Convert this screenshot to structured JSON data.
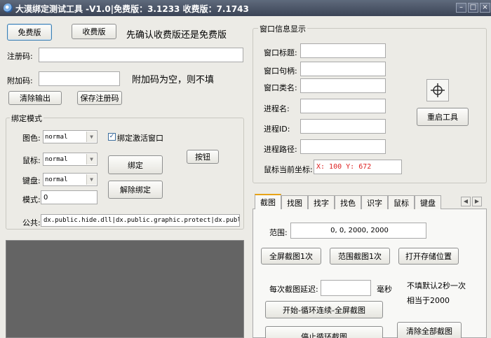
{
  "window": {
    "title": "大漠绑定测试工具 -V1.0|免费版：3.1233 收费版：7.1743",
    "min_glyph": "–",
    "max_glyph": "□",
    "close_glyph": "×"
  },
  "top": {
    "free_btn": "免费版",
    "paid_btn": "收费版",
    "hint": "先确认收费版还是免费版",
    "reg_label": "注册码:",
    "reg_value": "",
    "extra_label": "附加码:",
    "extra_value": "",
    "extra_hint": "附加码为空，则不填",
    "clear_btn": "清除输出",
    "save_reg_btn": "保存注册码"
  },
  "bind": {
    "legend": "绑定模式",
    "display_label": "图色:",
    "display_value": "normal",
    "mouse_label": "鼠标:",
    "mouse_value": "normal",
    "keypad_label": "键盘:",
    "keypad_value": "normal",
    "mode_label": "模式:",
    "mode_value": "0",
    "activate_label": "绑定激活窗口",
    "activate_checked": true,
    "bind_btn": "绑定",
    "unbind_btn": "解除绑定",
    "button_btn": "按钮",
    "public_label": "公共:",
    "public_value": "dx.public.hide.dll|dx.public.graphic.protect|dx.public"
  },
  "wininfo": {
    "legend": "窗口信息显示",
    "title_label": "窗口标题:",
    "title_value": "",
    "handle_label": "窗口句柄:",
    "handle_value": "",
    "class_label": "窗口类名:",
    "class_value": "",
    "proc_label": "进程名:",
    "proc_value": "",
    "pid_label": "进程ID:",
    "pid_value": "",
    "path_label": "进程路径:",
    "path_value": "",
    "mouse_label": "鼠标当前坐标:",
    "mouse_value": "X:   100  Y:   672",
    "restart_btn": "重启工具",
    "finder_icon": "crosshair-finder-icon"
  },
  "tabs": {
    "items": [
      "截图",
      "找图",
      "找字",
      "找色",
      "识字",
      "鼠标",
      "键盘"
    ],
    "active": "截图"
  },
  "screenshot": {
    "range_label": "范围:",
    "range_value": "0, 0, 2000, 2000",
    "full_once_btn": "全屏截图1次",
    "range_once_btn": "范围截图1次",
    "open_folder_btn": "打开存储位置",
    "delay_label": "每次截图延迟:",
    "delay_value": "",
    "delay_unit": "毫秒",
    "delay_hint1": "不填默认2秒一次",
    "delay_hint2": "相当于2000",
    "loop_start_btn": "开始-循环连续-全屏截图",
    "loop_stop_btn": "停止循环截图",
    "clear_all_btn": "清除全部截图"
  }
}
